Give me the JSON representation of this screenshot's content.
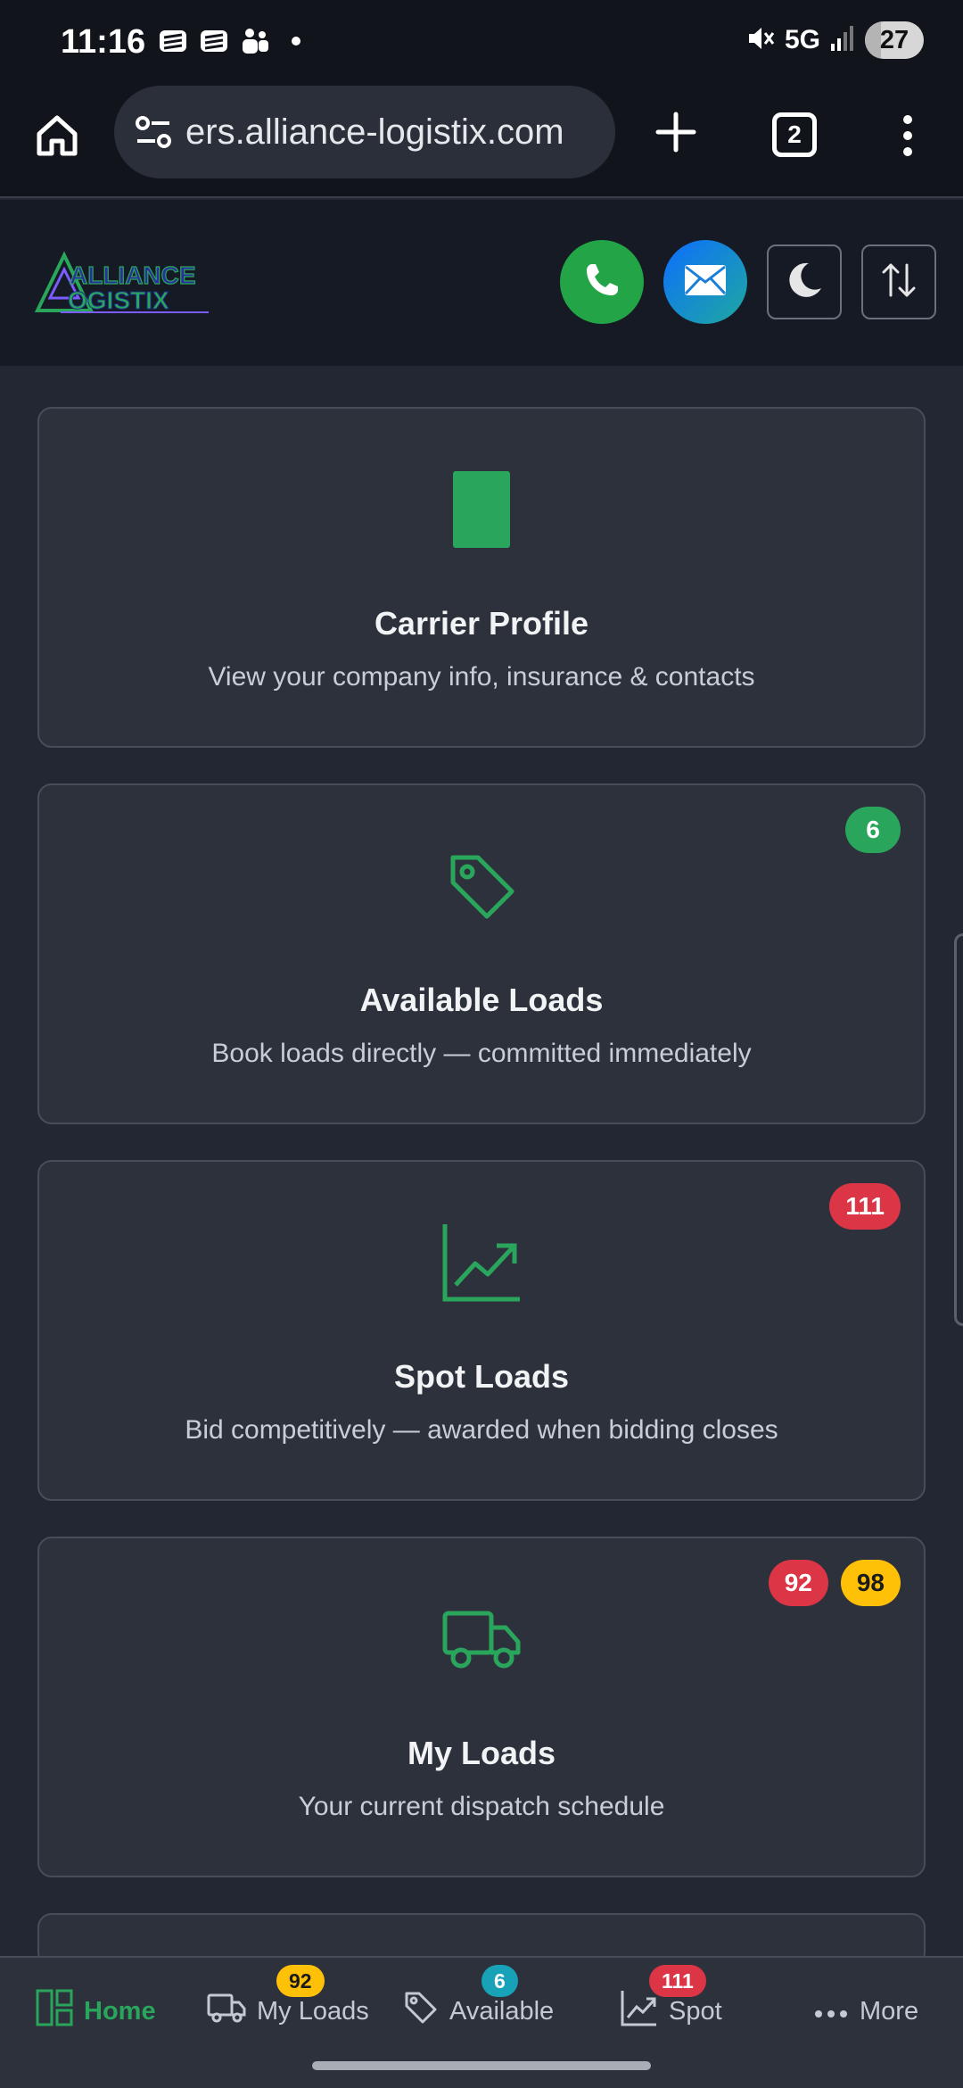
{
  "status_bar": {
    "time": "11:16",
    "network": "5G",
    "battery": "27",
    "battery_level_percent": 27,
    "icons": [
      "notification-app-icon",
      "notification-app-icon",
      "teams-icon",
      "dot-icon",
      "mute-icon",
      "signal-icon"
    ]
  },
  "browser": {
    "url": "ers.alliance-logistix.com",
    "tab_count": "2",
    "icons": [
      "home-icon",
      "site-settings-icon",
      "new-tab-icon",
      "tabs-icon",
      "more-vert-icon"
    ]
  },
  "header": {
    "logo_text": "ALLIANCE LOGISTIX",
    "icons": [
      "phone-icon",
      "mail-icon",
      "moon-icon",
      "sort-icon"
    ],
    "colors": {
      "phone": "#22a447",
      "mail": "#0d6efd"
    }
  },
  "cards": [
    {
      "title": "Carrier Profile",
      "description": "View your company info, insurance & contacts",
      "icon": "id-card-icon",
      "badges": []
    },
    {
      "title": "Available Loads",
      "description": "Book loads directly — committed immediately",
      "icon": "tag-icon",
      "badges": [
        {
          "value": "6",
          "color": "#2aa55c"
        }
      ]
    },
    {
      "title": "Spot Loads",
      "description": "Bid competitively — awarded when bidding closes",
      "icon": "chart-line-icon",
      "badges": [
        {
          "value": "111",
          "color": "#dc3545"
        }
      ]
    },
    {
      "title": "My Loads",
      "description": "Your current dispatch schedule",
      "icon": "truck-icon",
      "badges": [
        {
          "value": "92",
          "color": "#dc3545"
        },
        {
          "value": "98",
          "color": "#ffc107"
        }
      ]
    }
  ],
  "bottom_nav": {
    "home": "Home",
    "my_loads": "My Loads",
    "my_loads_badge": "92",
    "available": "Available",
    "available_badge": "6",
    "spot": "Spot",
    "spot_badge": "111",
    "more": "More"
  },
  "colors": {
    "accent": "#2aa55c",
    "background": "#222733",
    "card": "#2c313c"
  }
}
